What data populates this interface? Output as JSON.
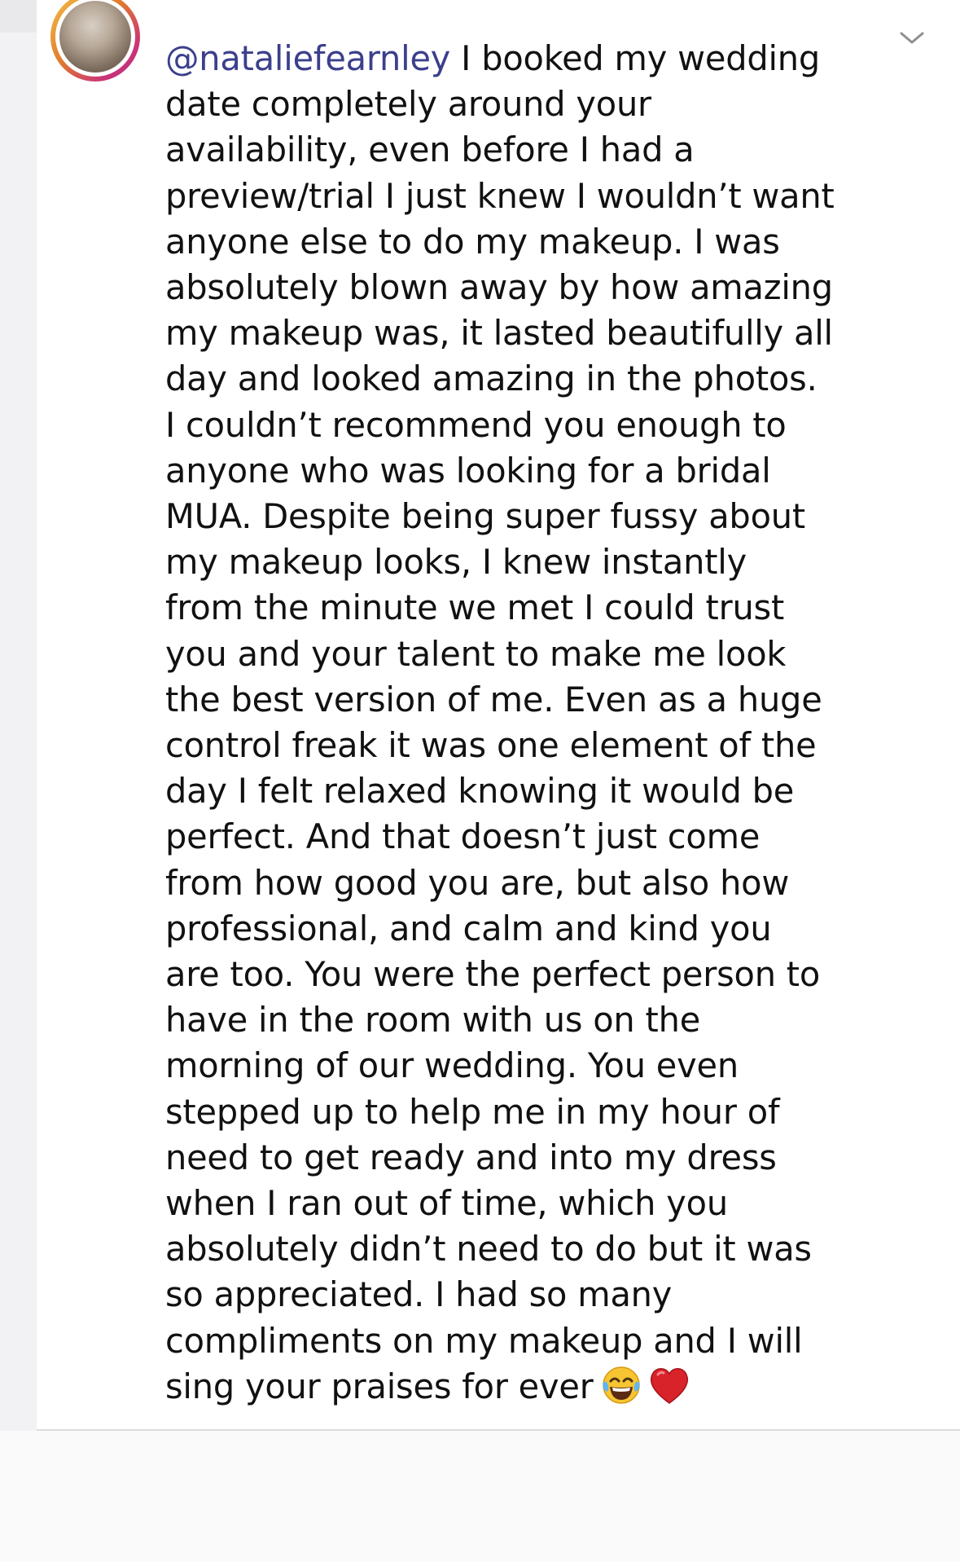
{
  "comment": {
    "username": "@nataliefearnley",
    "first_line_rest": " I booked my wedding",
    "lines": [
      "date completely around your",
      "availability, even before I had a",
      "preview/trial I just knew I wouldn’t want",
      "anyone else to do my makeup. I was",
      "absolutely blown away by how amazing",
      "my makeup was, it lasted beautifully all",
      "day and looked amazing in the photos.",
      "I couldn’t recommend you enough to",
      "anyone who was looking for a bridal",
      "MUA. Despite being super fussy about",
      "my makeup looks, I knew instantly",
      "from the minute we met I could trust",
      "you and your talent to make me look",
      "the best version of me. Even as a huge",
      "control freak it was one element of the",
      "day I felt relaxed knowing it would be",
      "perfect. And that doesn’t just come",
      "from how good you are, but also how",
      "professional, and calm and kind you",
      "are too. You were the perfect person to",
      "have in the room with us on the",
      "morning of our wedding. You even",
      "stepped up to help me in my hour of",
      "need to get ready and into my dress",
      "when I ran out of time, which you",
      "absolutely didn’t need to do but it was",
      "so appreciated. I had so many",
      "compliments on my makeup and I will"
    ],
    "last_line": "sing your praises for ever",
    "emojis": [
      "laughing-tears-emoji",
      "red-heart-emoji"
    ]
  },
  "icons": {
    "avatar": "profile-avatar",
    "collapse": "chevron-down-icon"
  },
  "colors": {
    "username": "#3b3f8c",
    "text": "#111111",
    "background": "#ffffff",
    "page_background": "#f2f2f4",
    "heart": "#d8232a",
    "emoji_face": "#f7c531"
  }
}
